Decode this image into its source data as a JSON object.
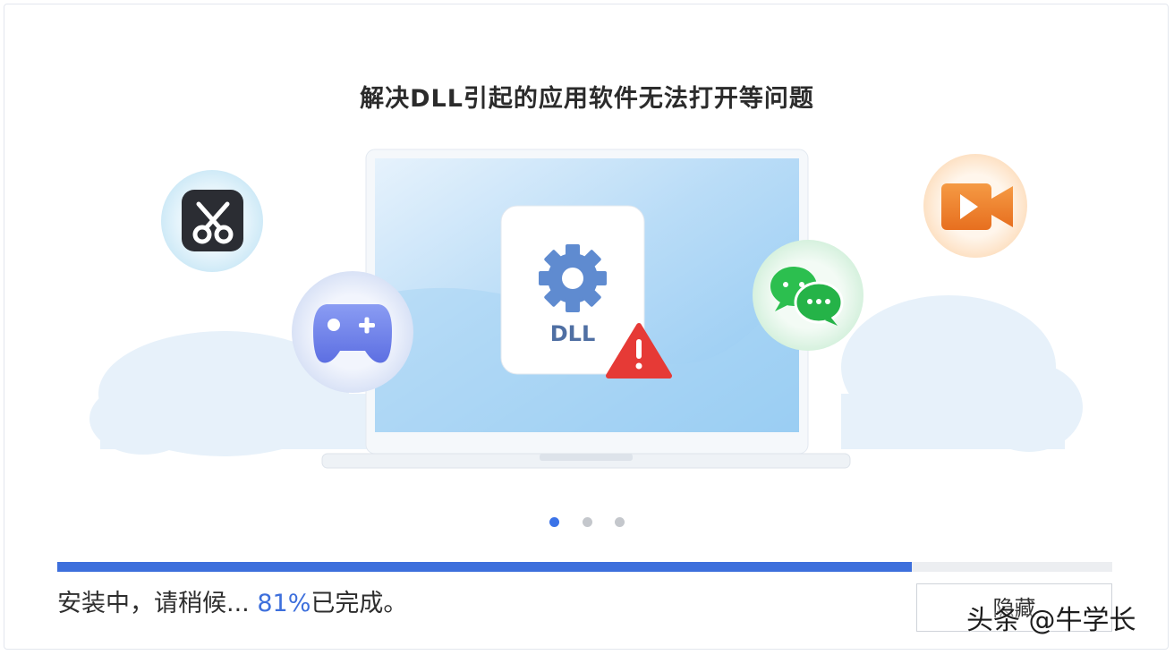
{
  "banner": {
    "title": "解决DLL引起的应用软件无法打开等问题",
    "dll_label": "DLL",
    "carousel_count": 3,
    "carousel_active_index": 0
  },
  "icons": {
    "screenshot_app": "scissors-icon",
    "game_app": "gamepad-icon",
    "dll_file": "gear-icon",
    "warning": "warning-icon",
    "chat_app": "wechat-icon",
    "video_app": "video-icon"
  },
  "install": {
    "progress": 0.81,
    "status_prefix": "安装中，请稍候... ",
    "status_percent": "81%",
    "status_suffix": "已完成。",
    "hide_label": "隐藏"
  },
  "watermark": "头条 @牛学长",
  "colors": {
    "accent": "#3d6fdc",
    "warning": "#e63a36",
    "chat": "#2cbf4f",
    "video": "#f07f2a"
  }
}
